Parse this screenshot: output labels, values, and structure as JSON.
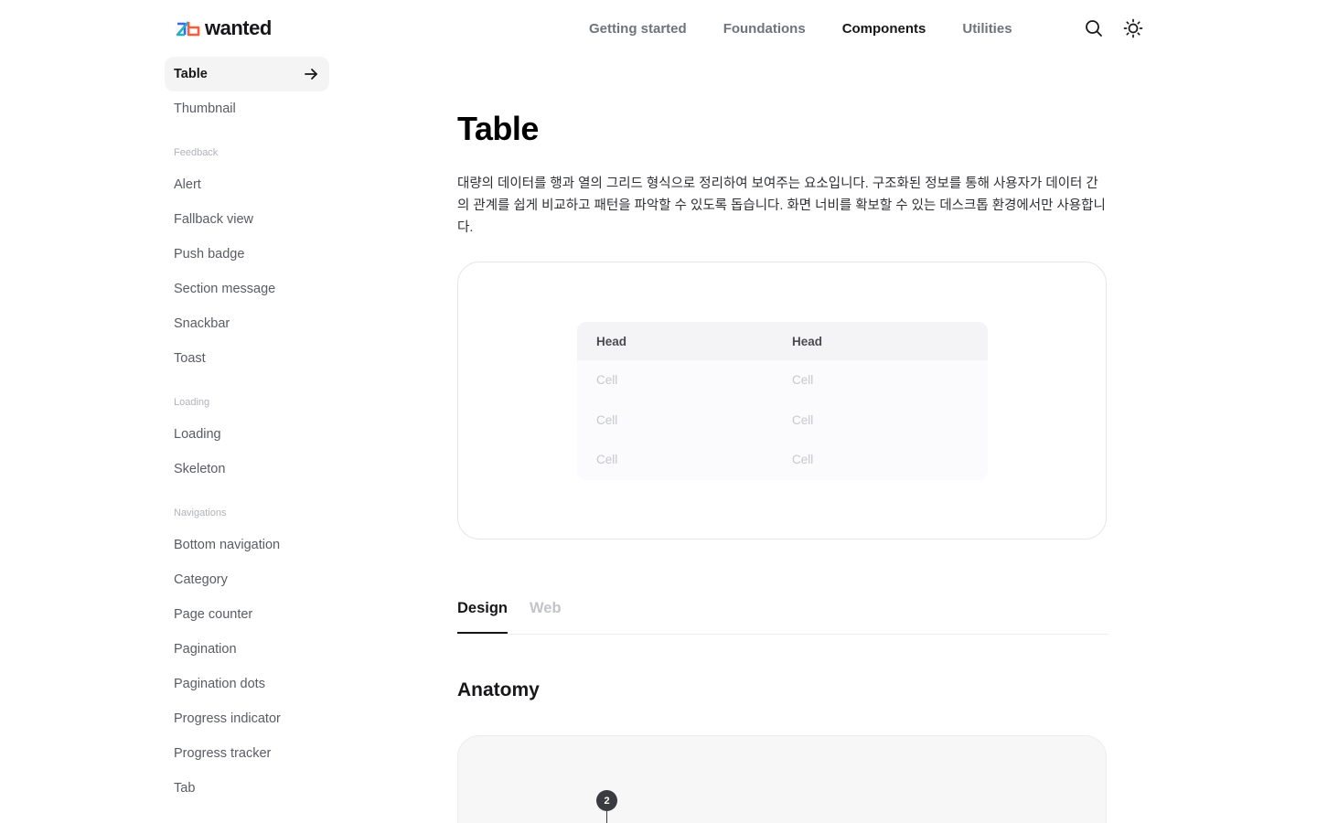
{
  "brand": {
    "name": "wanted"
  },
  "nav": {
    "items": [
      {
        "label": "Getting started",
        "active": false
      },
      {
        "label": "Foundations",
        "active": false
      },
      {
        "label": "Components",
        "active": true
      },
      {
        "label": "Utilities",
        "active": false
      }
    ],
    "icons": [
      "search-icon",
      "theme-toggle-icon"
    ]
  },
  "sidebar": {
    "active_item": "Table",
    "items_top": [
      "Thumbnail"
    ],
    "groups": [
      {
        "title": "Feedback",
        "items": [
          "Alert",
          "Fallback view",
          "Push badge",
          "Section message",
          "Snackbar",
          "Toast"
        ]
      },
      {
        "title": "Loading",
        "items": [
          "Loading",
          "Skeleton"
        ]
      },
      {
        "title": "Navigations",
        "items": [
          "Bottom navigation",
          "Category",
          "Page counter",
          "Pagination",
          "Pagination dots",
          "Progress indicator",
          "Progress tracker",
          "Tab"
        ]
      }
    ]
  },
  "main": {
    "title": "Table",
    "description": "대량의 데이터를 행과 열의 그리드 형식으로 정리하여 보여주는 요소입니다. 구조화된 정보를 통해 사용자가 데이터 간의 관계를 쉽게 비교하고 패턴을 파악할 수 있도록 돕습니다. 화면 너비를 확보할 수 있는 데스크톱 환경에서만 사용합니다.",
    "preview_table": {
      "headers": [
        "Head",
        "Head"
      ],
      "rows": [
        [
          "Cell",
          "Cell"
        ],
        [
          "Cell",
          "Cell"
        ],
        [
          "Cell",
          "Cell"
        ]
      ]
    },
    "tabs": [
      {
        "label": "Design",
        "active": true
      },
      {
        "label": "Web",
        "active": false
      }
    ],
    "section_title": "Anatomy",
    "anatomy_marker": "2"
  },
  "colors": {
    "text": "#171719",
    "muted": "#70737c",
    "accent_red": "#ff5a3c",
    "accent_blue": "#3366ff"
  }
}
